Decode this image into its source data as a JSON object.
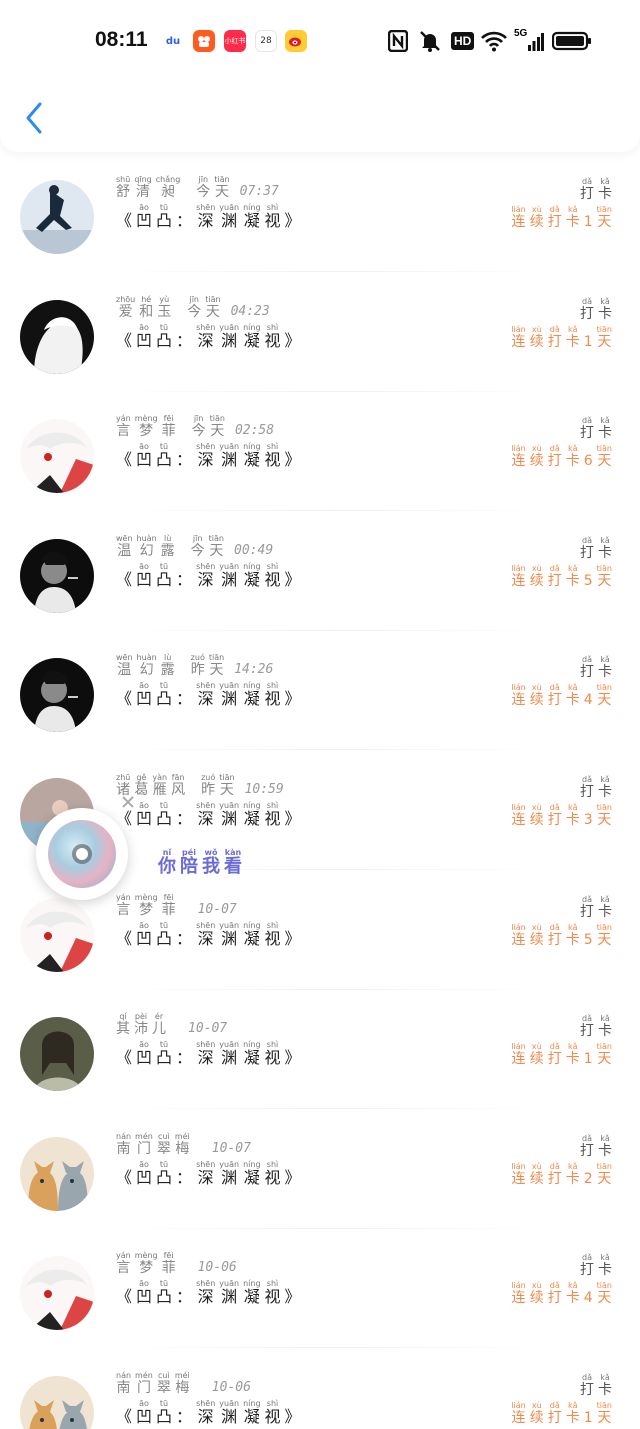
{
  "status_bar": {
    "time": "08:11",
    "apps": [
      "baidu-app-icon",
      "kuaishou-app-icon",
      "xiaohongshu-app-icon",
      "calendar-app-icon",
      "weibo-app-icon"
    ],
    "app_labels": {
      "baidu": "du",
      "xiaohongshu": "小红书",
      "calendar": "28"
    },
    "signal_label": "5G",
    "hd_label": "HD"
  },
  "header": {
    "back_icon": "chevron-left-icon",
    "accent": "#2a8cf0"
  },
  "colors": {
    "streak": "#ef8a4c",
    "song": "#6b6bd6"
  },
  "check_in_label": {
    "hz": [
      "打",
      "卡"
    ],
    "py": [
      "dǎ",
      "kǎ"
    ]
  },
  "book": {
    "open": "《",
    "close": "》",
    "chars": [
      {
        "hz": "凹",
        "py": "āo"
      },
      {
        "hz": "凸",
        "py": "tū"
      },
      {
        "hz": "：",
        "py": ""
      },
      {
        "hz": "深",
        "py": "shēn"
      },
      {
        "hz": "渊",
        "py": "yuān"
      },
      {
        "hz": "凝",
        "py": "níng"
      },
      {
        "hz": "视",
        "py": "shì"
      }
    ]
  },
  "streak": {
    "pre": [
      {
        "hz": "连",
        "py": "lián"
      },
      {
        "hz": "续",
        "py": "xù"
      },
      {
        "hz": "打",
        "py": "dǎ"
      },
      {
        "hz": "卡",
        "py": "kǎ"
      }
    ],
    "post": {
      "hz": "天",
      "py": "tiān"
    }
  },
  "entries": [
    {
      "name": [
        [
          "舒",
          "shū"
        ],
        [
          "清",
          "qīng"
        ],
        [
          "昶",
          "chǎng"
        ]
      ],
      "day": [
        [
          "今",
          "jīn"
        ],
        [
          "天",
          "tiān"
        ]
      ],
      "time": "07:37",
      "days": "1",
      "avatar": "skater"
    },
    {
      "name": [
        [
          "爱",
          "zhōu"
        ],
        [
          "和",
          "hé"
        ],
        [
          "玉",
          "yù"
        ]
      ],
      "day": [
        [
          "今",
          "jīn"
        ],
        [
          "天",
          "tiān"
        ]
      ],
      "time": "04:23",
      "days": "1",
      "avatar": "bw"
    },
    {
      "name": [
        [
          "言",
          "yán"
        ],
        [
          "梦",
          "mèng"
        ],
        [
          "菲",
          "fēi"
        ]
      ],
      "day": [
        [
          "今",
          "jīn"
        ],
        [
          "天",
          "tiān"
        ]
      ],
      "time": "02:58",
      "days": "6",
      "avatar": "anime"
    },
    {
      "name": [
        [
          "温",
          "wēn"
        ],
        [
          "幻",
          "huàn"
        ],
        [
          "露",
          "lù"
        ]
      ],
      "day": [
        [
          "今",
          "jīn"
        ],
        [
          "天",
          "tiān"
        ]
      ],
      "time": "00:49",
      "days": "5",
      "avatar": "smoke"
    },
    {
      "name": [
        [
          "温",
          "wēn"
        ],
        [
          "幻",
          "huàn"
        ],
        [
          "露",
          "lù"
        ]
      ],
      "day": [
        [
          "昨",
          "zuó"
        ],
        [
          "天",
          "tiān"
        ]
      ],
      "time": "14:26",
      "days": "4",
      "avatar": "smoke"
    },
    {
      "name": [
        [
          "诸",
          "zhū"
        ],
        [
          "葛",
          "gě"
        ],
        [
          "雁",
          "yàn"
        ],
        [
          "风",
          "fān"
        ]
      ],
      "day": [
        [
          "昨",
          "zuó"
        ],
        [
          "天",
          "tiān"
        ]
      ],
      "time": "10:59",
      "days": "3",
      "avatar": "blue"
    },
    {
      "name": [
        [
          "言",
          "yán"
        ],
        [
          "梦",
          "mèng"
        ],
        [
          "菲",
          "fēi"
        ]
      ],
      "day": [],
      "time": "10-07",
      "days": "5",
      "avatar": "anime"
    },
    {
      "name": [
        [
          "其",
          "qí"
        ],
        [
          "沛",
          "pèi"
        ],
        [
          "儿",
          "ér"
        ]
      ],
      "day": [],
      "time": "10-07",
      "days": "1",
      "avatar": "dark"
    },
    {
      "name": [
        [
          "南",
          "nán"
        ],
        [
          "门",
          "mén"
        ],
        [
          "翠",
          "cuì"
        ],
        [
          "梅",
          "méi"
        ]
      ],
      "day": [],
      "time": "10-07",
      "days": "2",
      "avatar": "cats"
    },
    {
      "name": [
        [
          "言",
          "yán"
        ],
        [
          "梦",
          "mèng"
        ],
        [
          "菲",
          "fēi"
        ]
      ],
      "day": [],
      "time": "10-06",
      "days": "4",
      "avatar": "anime"
    },
    {
      "name": [
        [
          "南",
          "nán"
        ],
        [
          "门",
          "mén"
        ],
        [
          "翠",
          "cuì"
        ],
        [
          "梅",
          "méi"
        ]
      ],
      "day": [],
      "time": "10-06",
      "days": "1",
      "avatar": "cats"
    }
  ],
  "music_widget": {
    "song": [
      {
        "hz": "你",
        "py": "nǐ"
      },
      {
        "hz": "陪",
        "py": "péi"
      },
      {
        "hz": "我",
        "py": "wǒ"
      },
      {
        "hz": "看",
        "py": "kàn"
      }
    ],
    "close_icon": "close-icon",
    "disc_icon": "music-disc-icon"
  }
}
